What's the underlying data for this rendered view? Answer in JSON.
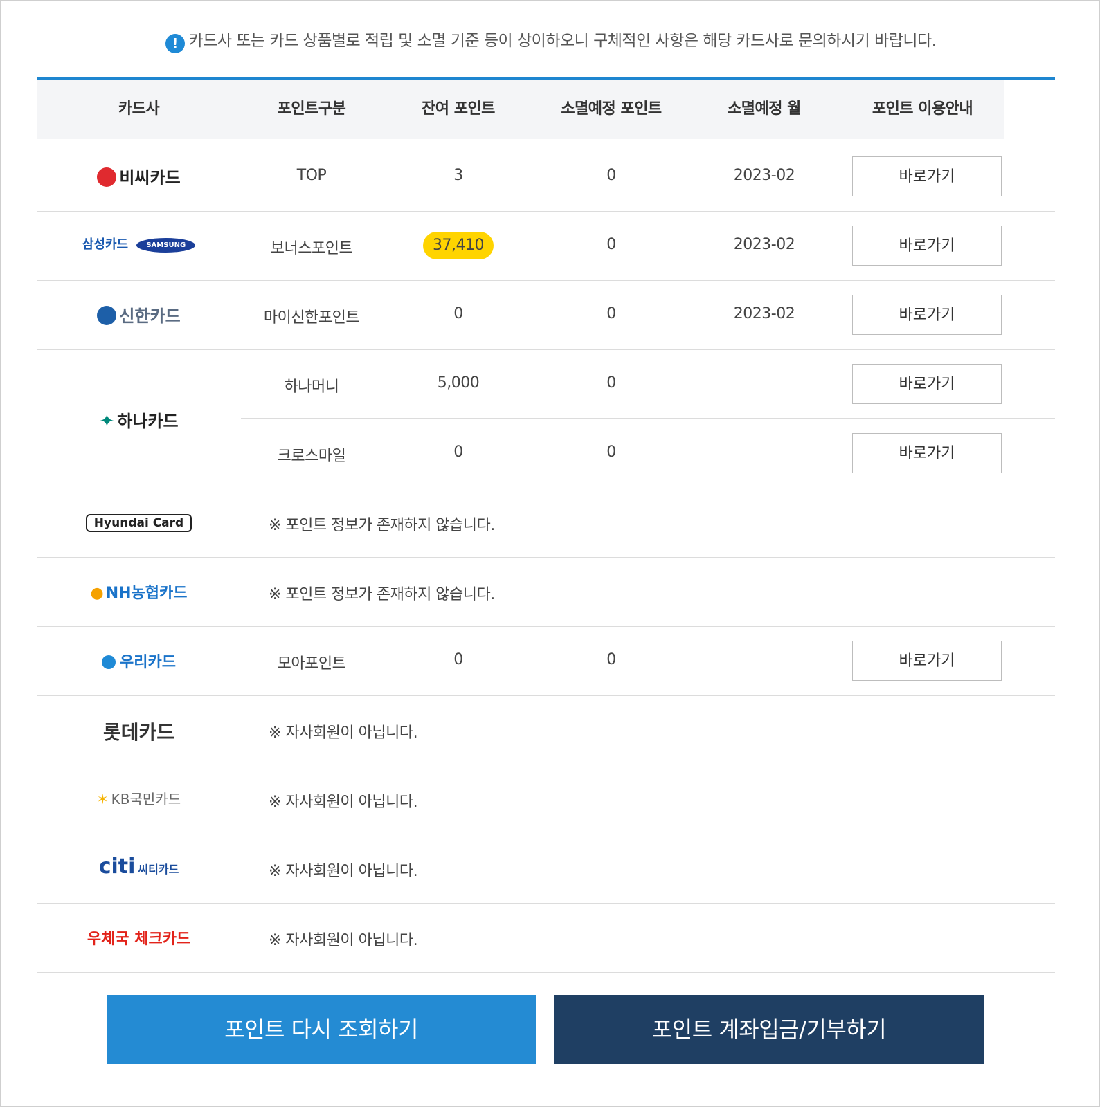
{
  "notice": {
    "icon": "info-icon",
    "text": "카드사 또는 카드 상품별로 적립 및 소멸 기준 등이 상이하오니 구체적인 사항은 해당 카드사로 문의하시기 바랍니다."
  },
  "table": {
    "headers": [
      "카드사",
      "포인트구분",
      "잔여 포인트",
      "소멸예정 포인트",
      "소멸예정 월",
      "포인트 이용안내"
    ],
    "rows": [
      {
        "card": "비씨카드",
        "type": "TOP",
        "balance": "3",
        "expiring": "0",
        "month": "2023-02",
        "action": "바로가기"
      },
      {
        "card": "삼성카드",
        "card_sub": "SAMSUNG",
        "type": "보너스포인트",
        "balance": "37,410",
        "expiring": "0",
        "month": "2023-02",
        "action": "바로가기"
      },
      {
        "card": "신한카드",
        "type": "마이신한포인트",
        "balance": "0",
        "expiring": "0",
        "month": "2023-02",
        "action": "바로가기"
      },
      {
        "card": "하나카드",
        "sub_rows": [
          {
            "type": "하나머니",
            "balance": "5,000",
            "expiring": "0",
            "action": "바로가기"
          },
          {
            "type": "크로스마일",
            "balance": "0",
            "expiring": "0",
            "action": "바로가기"
          }
        ]
      },
      {
        "card": "Hyundai Card",
        "message": "※ 포인트 정보가 존재하지 않습니다."
      },
      {
        "card": "NH농협카드",
        "message": "※ 포인트 정보가 존재하지 않습니다."
      },
      {
        "card": "우리카드",
        "type": "모아포인트",
        "balance": "0",
        "expiring": "0",
        "action": "바로가기"
      },
      {
        "card": "롯데카드",
        "message": "※ 자사회원이 아닙니다."
      },
      {
        "card": "KB국민카드",
        "message": "※ 자사회원이 아닙니다."
      },
      {
        "card": "citi",
        "card_sub": "씨티카드",
        "message": "※ 자사회원이 아닙니다."
      },
      {
        "card": "우체국 체크카드",
        "message": "※ 자사회원이 아닙니다."
      }
    ]
  },
  "buttons": {
    "refresh": "포인트 다시 조회하기",
    "deposit": "포인트 계좌입금/기부하기"
  },
  "colors": {
    "accent": "#1e86d0",
    "refresh_bg": "#248bd3",
    "deposit_bg": "#1f3f63",
    "highlight": "#ffd400"
  }
}
